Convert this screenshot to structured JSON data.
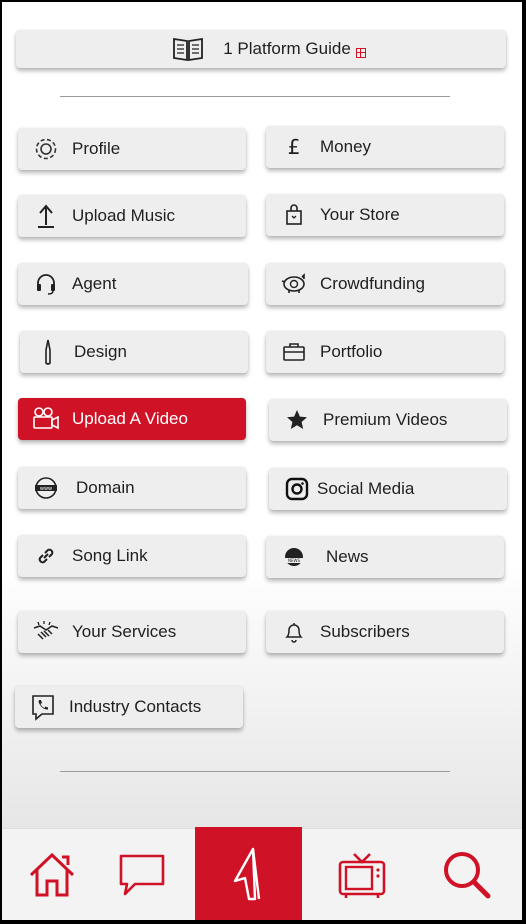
{
  "guide": {
    "label": "1 Platform Guide",
    "icon": "book-icon"
  },
  "menu": [
    {
      "label": "Profile",
      "icon": "gear-icon"
    },
    {
      "label": "Money",
      "icon": "pound-icon"
    },
    {
      "label": "Upload Music",
      "icon": "upload-arrow-icon"
    },
    {
      "label": "Your Store",
      "icon": "shopping-bag-icon"
    },
    {
      "label": "Agent",
      "icon": "headset-icon"
    },
    {
      "label": "Crowdfunding",
      "icon": "piggy-bank-icon"
    },
    {
      "label": "Design",
      "icon": "paintbrush-icon"
    },
    {
      "label": "Portfolio",
      "icon": "briefcase-icon"
    },
    {
      "label": "Upload A Video",
      "icon": "video-camera-icon"
    },
    {
      "label": "Premium Videos",
      "icon": "star-icon"
    },
    {
      "label": "Domain",
      "icon": "www-globe-icon"
    },
    {
      "label": "Social Media",
      "icon": "instagram-icon"
    },
    {
      "label": "Song Link",
      "icon": "link-icon"
    },
    {
      "label": "News",
      "icon": "news-globe-icon"
    },
    {
      "label": "Your Services",
      "icon": "handshake-icon"
    },
    {
      "label": "Subscribers",
      "icon": "bell-icon"
    },
    {
      "label": "Industry Contacts",
      "icon": "phone-chat-icon"
    }
  ],
  "nav": {
    "items": [
      "home-icon",
      "chat-bubble-icon",
      "platform-logo-icon",
      "tv-icon",
      "search-icon"
    ]
  },
  "colors": {
    "accent": "#d01227",
    "card": "#efeeee",
    "text": "#1f1f1f"
  }
}
